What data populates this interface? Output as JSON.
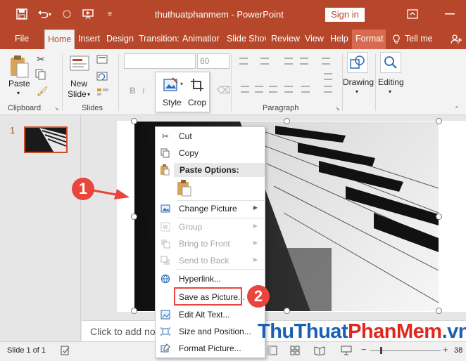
{
  "window": {
    "title": "thuthuatphanmem  -  PowerPoint",
    "signin_label": "Sign in",
    "icons": [
      "save-icon",
      "undo-icon",
      "redo-icon",
      "start-from-beginning-icon",
      "customize-toolbar-icon",
      "ribbon-display-options-icon",
      "minimize-icon",
      "share-icon"
    ]
  },
  "tabs": [
    {
      "label": "File"
    },
    {
      "label": "Home"
    },
    {
      "label": "Insert"
    },
    {
      "label": "Design"
    },
    {
      "label": "Transition:"
    },
    {
      "label": "Animatior"
    },
    {
      "label": "Slide Shov"
    },
    {
      "label": "Review"
    },
    {
      "label": "View"
    },
    {
      "label": "Help"
    },
    {
      "label": "Format"
    },
    {
      "label": "Tell me"
    }
  ],
  "ribbon": {
    "clipboard": {
      "paste_label": "Paste",
      "group_label": "Clipboard"
    },
    "slides": {
      "new_slide_label_1": "New",
      "new_slide_label_2": "Slide",
      "group_label": "Slides"
    },
    "font": {
      "size_value": "60",
      "bold_label": "B",
      "italic_label": "I"
    },
    "paragraph": {
      "group_label": "Paragraph"
    },
    "drawing_label": "Drawing",
    "editing_label": "Editing",
    "mini_toolbar": {
      "style_label": "Style",
      "crop_label": "Crop"
    }
  },
  "slide_pane": {
    "slide_number": "1"
  },
  "notes": {
    "placeholder": "Click to add no"
  },
  "status": {
    "slide_info": "Slide 1 of 1",
    "zoom_text": "38"
  },
  "context_menu": {
    "cut": "Cut",
    "copy": "Copy",
    "paste_options": "Paste Options:",
    "change_picture": "Change Picture",
    "group": "Group",
    "bring_to_front": "Bring to Front",
    "send_to_back": "Send to Back",
    "hyperlink": "Hyperlink...",
    "save_as_picture": "Save as Picture...",
    "edit_alt_text": "Edit Alt Text...",
    "size_and_position": "Size and Position...",
    "format_picture": "Format Picture..."
  },
  "annotations": {
    "step1": "1",
    "step2": "2"
  },
  "watermark": {
    "part1": "ThuThuat",
    "part2": "PhanMem",
    "part3": ".vn"
  },
  "colors": {
    "accent": "#b7472a",
    "annotation": "#e8453c",
    "watermark_blue": "#1a5fb4",
    "watermark_red": "#e1261c"
  }
}
